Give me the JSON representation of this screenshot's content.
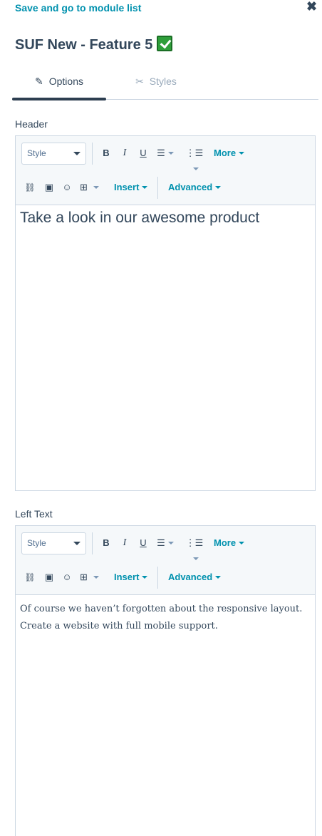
{
  "topbar": {
    "back_label": "Save and go to module list"
  },
  "title": "SUF New - Feature 5",
  "tabs": [
    {
      "label": "Options",
      "icon": "pencil-icon",
      "active": true
    },
    {
      "label": "Styles",
      "icon": "brush-icon",
      "active": false
    }
  ],
  "fields": [
    {
      "label": "Header",
      "toolbar": {
        "style_value": "Style",
        "more_label": "More",
        "insert_label": "Insert",
        "advanced_label": "Advanced"
      },
      "content": "Take a look in our awesome product"
    },
    {
      "label": "Left Text",
      "toolbar": {
        "style_value": "Style",
        "more_label": "More",
        "insert_label": "Insert",
        "advanced_label": "Advanced"
      },
      "content": "Of course we haven’t forgotten about the responsive layout. Create a website with full mobile support."
    }
  ],
  "colors": {
    "accent": "#0091ae",
    "text": "#33475b",
    "toolbar_bg": "#f5f8fa",
    "border": "#cbd6e2"
  }
}
